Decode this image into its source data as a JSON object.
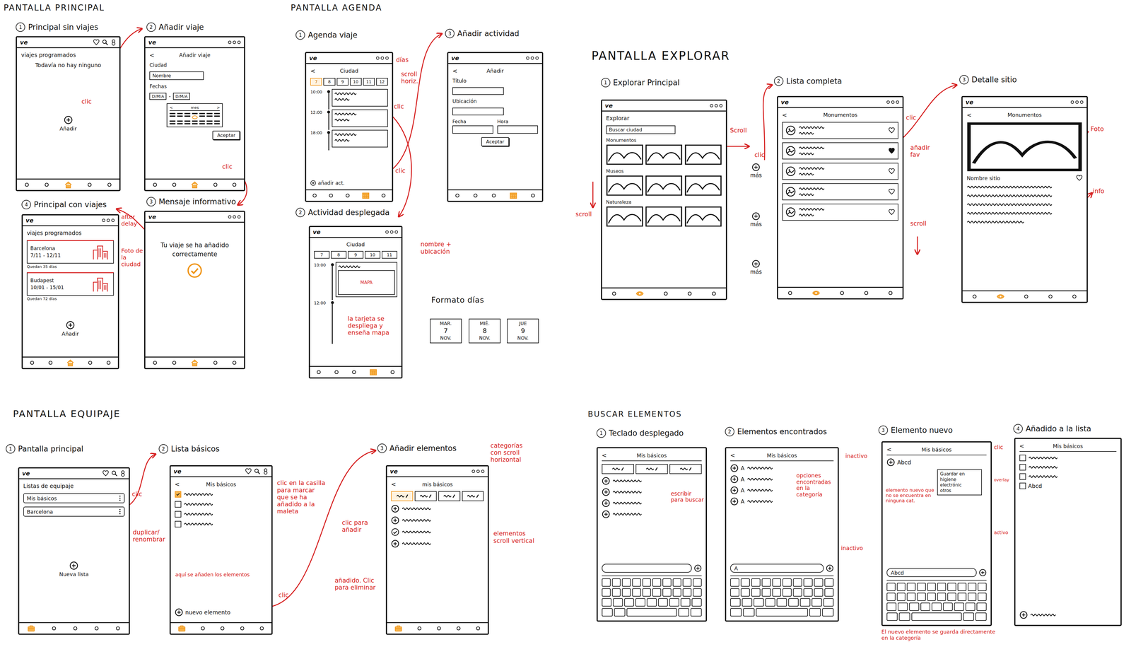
{
  "sections": [
    {
      "title": "PANTALLA PRINCIPAL",
      "screens": [
        {
          "num": "1",
          "label": "Principal sin viajes",
          "topbar": "icons",
          "logo": "ve",
          "items": [
            {
              "kind": "text",
              "text": "viajes programados",
              "align": "left"
            },
            {
              "kind": "text",
              "text": "Todavía no hay ninguno",
              "align": "center"
            },
            {
              "kind": "add",
              "text": "Añadir"
            }
          ]
        },
        {
          "num": "2",
          "label": "Añadir viaje",
          "topbar": "dots",
          "logo": "ve",
          "items": [
            {
              "kind": "header",
              "back": "<",
              "text": "Añadir viaje"
            },
            {
              "kind": "label",
              "text": "Ciudad"
            },
            {
              "kind": "field",
              "text": "Nombre"
            },
            {
              "kind": "label",
              "text": "Fechas"
            },
            {
              "kind": "dates",
              "a": "D/M/A",
              "sep": "-",
              "b": "D/M/A"
            },
            {
              "kind": "calendar",
              "prev": "<",
              "title": "mes",
              "next": ">"
            },
            {
              "kind": "button",
              "text": "Aceptar",
              "align": "right"
            }
          ]
        },
        {
          "num": "3",
          "label": "Mensaje informativo",
          "topbar": "dots",
          "logo": "ve",
          "items": [
            {
              "kind": "message",
              "text": "Tu viaje se ha añadido correctamente"
            },
            {
              "kind": "check"
            }
          ]
        },
        {
          "num": "4",
          "label": "Principal con viajes",
          "topbar": "dots",
          "logo": "ve",
          "items": [
            {
              "kind": "text",
              "text": "viajes programados",
              "align": "left"
            },
            {
              "kind": "trip",
              "city": "Barcelona",
              "dates": "7/11 - 12/11",
              "note": "Quedan 35 días"
            },
            {
              "kind": "trip",
              "city": "Budapest",
              "dates": "10/01 - 15/01",
              "note": "Quedan 72 días"
            },
            {
              "kind": "add",
              "text": "Añadir"
            }
          ]
        }
      ],
      "notes": [
        "clic",
        "clic",
        "Foto de la ciudad",
        "after delay"
      ]
    },
    {
      "title": "PANTALLA AGENDA",
      "screens": [
        {
          "num": "1",
          "label": "Agenda viaje",
          "topbar": "dots",
          "logo": "ve",
          "items": [
            {
              "kind": "header",
              "back": "<",
              "text": "Ciudad"
            },
            {
              "kind": "days",
              "days": [
                {
                  "text": "7",
                  "selected": true
                },
                {
                  "text": "8",
                  "selected": false
                },
                {
                  "text": "9",
                  "selected": false
                },
                {
                  "text": "10",
                  "selected": false
                },
                {
                  "text": "11",
                  "selected": false
                },
                {
                  "text": "12",
                  "selected": false
                }
              ]
            },
            {
              "kind": "timeline",
              "entries": [
                {
                  "time": "10:00",
                  "kind": "card"
                },
                {
                  "time": "12:00",
                  "kind": "card"
                },
                {
                  "time": "18:00",
                  "kind": "card"
                }
              ]
            },
            {
              "kind": "addact",
              "text": "añadir act."
            }
          ]
        },
        {
          "num": "2",
          "label": "Actividad desplegada",
          "topbar": "dots",
          "logo": "ve",
          "items": [
            {
              "kind": "header",
              "text": "Ciudad"
            },
            {
              "kind": "days",
              "days": [
                {
                  "text": "7",
                  "selected": false
                },
                {
                  "text": "8",
                  "selected": false
                },
                {
                  "text": "9",
                  "selected": false
                },
                {
                  "text": "10",
                  "selected": false
                },
                {
                  "text": "11",
                  "selected": false
                }
              ]
            },
            {
              "kind": "timeline",
              "entries": [
                {
                  "time": "10:00",
                  "kind": "map",
                  "map": "MAPA"
                },
                {
                  "time": "12:00",
                  "kind": "empty"
                }
              ]
            }
          ]
        },
        {
          "num": "3",
          "label": "Añadir actividad",
          "topbar": "dots",
          "logo": "ve",
          "items": [
            {
              "kind": "header",
              "back": "<",
              "text": "Añadir"
            },
            {
              "kind": "label",
              "text": "Título"
            },
            {
              "kind": "field"
            },
            {
              "kind": "label",
              "text": "Ubicación"
            },
            {
              "kind": "field"
            },
            {
              "kind": "pair",
              "labels": [
                "Fecha",
                "Hora"
              ]
            },
            {
              "kind": "button",
              "text": "Aceptar",
              "align": "center"
            }
          ]
        }
      ],
      "notes": [
        "días",
        "scroll horiz.",
        "clic",
        "clic",
        "nombre + ubicación",
        "la tarjeta se despliega y enseña mapa"
      ],
      "format": {
        "title": "Formato días",
        "days": [
          {
            "dow": "MAR.",
            "day": "7",
            "month": "NOV."
          },
          {
            "dow": "MIÉ.",
            "day": "8",
            "month": "NOV."
          },
          {
            "dow": "JUE",
            "day": "9",
            "month": "NOV."
          }
        ]
      }
    },
    {
      "title": "PANTALLA EXPLORAR",
      "screens": [
        {
          "num": "1",
          "label": "Explorar Principal",
          "topbar": "dots",
          "logo": "ve",
          "items": [
            {
              "kind": "text",
              "text": "Explorar",
              "align": "left"
            },
            {
              "kind": "field",
              "text": "Buscar ciudad"
            },
            {
              "kind": "gallery",
              "title": "Monumentos"
            },
            {
              "kind": "gallery",
              "title": "Museos"
            },
            {
              "kind": "gallery",
              "title": "Naturaleza"
            }
          ]
        },
        {
          "num": "2",
          "label": "Lista completa",
          "topbar": "dots",
          "logo": "ve",
          "items": [
            {
              "kind": "header",
              "back": "<",
              "text": "Monumentos"
            },
            {
              "kind": "placerow",
              "fav": false
            },
            {
              "kind": "placerow",
              "fav": true
            },
            {
              "kind": "placerow",
              "fav": false
            },
            {
              "kind": "placerow",
              "fav": false
            },
            {
              "kind": "placerow",
              "fav": false
            }
          ]
        },
        {
          "num": "3",
          "label": "Detalle sitio",
          "topbar": "dots",
          "logo": "ve",
          "items": [
            {
              "kind": "header",
              "back": "<",
              "text": "Monumentos"
            },
            {
              "kind": "photo"
            },
            {
              "kind": "namerow",
              "text": "Nombre sitio",
              "fav": false
            },
            {
              "kind": "waves",
              "count": 5
            }
          ]
        }
      ],
      "more": [
        "más",
        "más",
        "más"
      ],
      "notes": [
        "Scroll",
        "clic",
        "scroll",
        "clic",
        "añadir fav",
        "scroll",
        "Foto",
        "info"
      ]
    },
    {
      "title": "PANTALLA EQUIPAJE",
      "screens": [
        {
          "num": "1",
          "label": "Pantalla principal",
          "topbar": "icons",
          "logo": "ve",
          "items": [
            {
              "kind": "text",
              "text": "Listas de equipaje",
              "align": "left"
            },
            {
              "kind": "option",
              "text": "Mis básicos"
            },
            {
              "kind": "option",
              "text": "Barcelona"
            },
            {
              "kind": "add",
              "text": "Nueva lista"
            }
          ]
        },
        {
          "num": "2",
          "label": "Lista básicos",
          "topbar": "icons",
          "logo": "ve",
          "items": [
            {
              "kind": "header",
              "back": "<",
              "text": "Mis básicos"
            },
            {
              "kind": "checkrow",
              "checked": true
            },
            {
              "kind": "checkrow",
              "checked": false
            },
            {
              "kind": "checkrow",
              "checked": false
            },
            {
              "kind": "checkrow",
              "checked": false
            },
            {
              "kind": "newitem",
              "text": "nuevo elemento"
            }
          ]
        },
        {
          "num": "3",
          "label": "Añadir elementos",
          "topbar": "dots",
          "logo": "ve",
          "items": [
            {
              "kind": "header",
              "back": "<",
              "text": "mis básicos"
            },
            {
              "kind": "tabs",
              "tabs": [
                {
                  "selected": true
                },
                {
                  "selected": false
                },
                {
                  "selected": false
                },
                {
                  "selected": false
                }
              ]
            },
            {
              "kind": "addrow",
              "added": false
            },
            {
              "kind": "addrow",
              "added": false
            },
            {
              "kind": "addrow",
              "added": true
            },
            {
              "kind": "addrow",
              "added": false
            }
          ]
        }
      ],
      "notes": [
        "clic",
        "duplicar/ renombrar",
        "clic en la casilla para marcar que se ha añadido a la maleta",
        "aquí se añaden los elementos",
        "clic",
        "categorías con scroll horizontal",
        "clic para añadir",
        "añadido. Clic para eliminar",
        "elementos scroll vertical"
      ]
    },
    {
      "title": "BUSCAR ELEMENTOS",
      "screens": [
        {
          "num": "1",
          "label": "Teclado desplegado",
          "topbar": "none",
          "items": [
            {
              "kind": "header",
              "back": "<",
              "text": "Mis básicos"
            },
            {
              "kind": "tabs",
              "tabs": [
                {
                  "selected": false
                },
                {
                  "selected": false
                },
                {
                  "selected": false
                }
              ]
            },
            {
              "kind": "addrow",
              "added": false
            },
            {
              "kind": "addrow",
              "added": false
            },
            {
              "kind": "addrow",
              "added": false
            },
            {
              "kind": "addrow",
              "added": false
            },
            {
              "kind": "input"
            },
            {
              "kind": "keyboard"
            }
          ]
        },
        {
          "num": "2",
          "label": "Elementos encontrados",
          "topbar": "none",
          "items": [
            {
              "kind": "header",
              "back": "<",
              "text": "Mis básicos"
            },
            {
              "kind": "foundrow",
              "text": "A"
            },
            {
              "kind": "foundrow",
              "text": "A"
            },
            {
              "kind": "foundrow",
              "text": "A"
            },
            {
              "kind": "foundrow",
              "text": "A"
            },
            {
              "kind": "input",
              "text": "A"
            },
            {
              "kind": "keyboard"
            }
          ]
        },
        {
          "num": "3",
          "label": "Elemento nuevo",
          "topbar": "none",
          "items": [
            {
              "kind": "header",
              "back": "<",
              "text": "Mis básicos"
            },
            {
              "kind": "addrow",
              "added": false,
              "text": "Abcd"
            },
            {
              "kind": "overlay",
              "title": "Guardar en",
              "options": [
                "higiene",
                "electrónic",
                "otros"
              ]
            },
            {
              "kind": "input",
              "text": "Abcd"
            },
            {
              "kind": "keyboard"
            }
          ]
        },
        {
          "num": "4",
          "label": "Añadido a la lista",
          "topbar": "none",
          "items": [
            {
              "kind": "header",
              "back": "<",
              "text": "Mis básicos"
            },
            {
              "kind": "checkrow",
              "checked": false
            },
            {
              "kind": "checkrow",
              "checked": false
            },
            {
              "kind": "checkrow",
              "checked": false
            },
            {
              "kind": "checkrow",
              "checked": false,
              "text": "Abcd"
            },
            {
              "kind": "newitem"
            }
          ]
        }
      ],
      "notes": [
        "escribir para buscar",
        "opciones encontradas en la categoría",
        "inactivo",
        "inactivo",
        "clic",
        "overlay",
        "elemento nuevo que no se encuentra en ninguna cat.",
        "activo",
        "El nuevo elemento se guarda directamente en la categoría"
      ]
    }
  ]
}
